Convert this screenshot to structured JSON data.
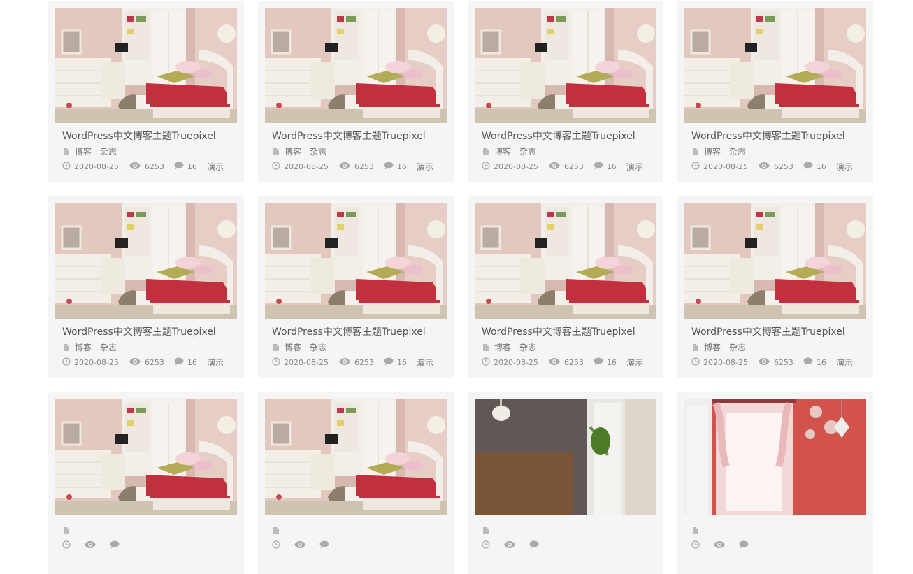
{
  "cards": [
    {
      "title": "WordPress中文博客主题Truepixel",
      "categories": [
        "博客",
        "杂志"
      ],
      "date": "2020-08-25",
      "views": "6253",
      "comments": "16",
      "tag": "演示",
      "image": "bedroom-white"
    },
    {
      "title": "WordPress中文博客主题Truepixel",
      "categories": [
        "博客",
        "杂志"
      ],
      "date": "2020-08-25",
      "views": "6253",
      "comments": "16",
      "tag": "演示",
      "image": "bedroom-white"
    },
    {
      "title": "WordPress中文博客主题Truepixel",
      "categories": [
        "博客",
        "杂志"
      ],
      "date": "2020-08-25",
      "views": "6253",
      "comments": "16",
      "tag": "演示",
      "image": "bedroom-white"
    },
    {
      "title": "WordPress中文博客主题Truepixel",
      "categories": [
        "博客",
        "杂志"
      ],
      "date": "2020-08-25",
      "views": "6253",
      "comments": "16",
      "tag": "演示",
      "image": "bedroom-white"
    },
    {
      "title": "WordPress中文博客主题Truepixel",
      "categories": [
        "博客",
        "杂志"
      ],
      "date": "2020-08-25",
      "views": "6253",
      "comments": "16",
      "tag": "演示",
      "image": "bedroom-white"
    },
    {
      "title": "WordPress中文博客主题Truepixel",
      "categories": [
        "博客",
        "杂志"
      ],
      "date": "2020-08-25",
      "views": "6253",
      "comments": "16",
      "tag": "演示",
      "image": "bedroom-white"
    },
    {
      "title": "WordPress中文博客主题Truepixel",
      "categories": [
        "博客",
        "杂志"
      ],
      "date": "2020-08-25",
      "views": "6253",
      "comments": "16",
      "tag": "演示",
      "image": "bedroom-white"
    },
    {
      "title": "WordPress中文博客主题Truepixel",
      "categories": [
        "博客",
        "杂志"
      ],
      "date": "2020-08-25",
      "views": "6253",
      "comments": "16",
      "tag": "演示",
      "image": "bedroom-white"
    },
    {
      "title": "",
      "categories": [],
      "date": "",
      "views": "",
      "comments": "",
      "tag": "",
      "image": "bedroom-white"
    },
    {
      "title": "",
      "categories": [],
      "date": "",
      "views": "",
      "comments": "",
      "tag": "",
      "image": "bedroom-white"
    },
    {
      "title": "",
      "categories": [],
      "date": "",
      "views": "",
      "comments": "",
      "tag": "",
      "image": "bedroom-dark"
    },
    {
      "title": "",
      "categories": [],
      "date": "",
      "views": "",
      "comments": "",
      "tag": "",
      "image": "bedroom-red"
    }
  ],
  "colors": {
    "card_bg": "#f5f5f5",
    "title": "#555555",
    "meta": "#888888",
    "icon": "#bbbbbb"
  }
}
